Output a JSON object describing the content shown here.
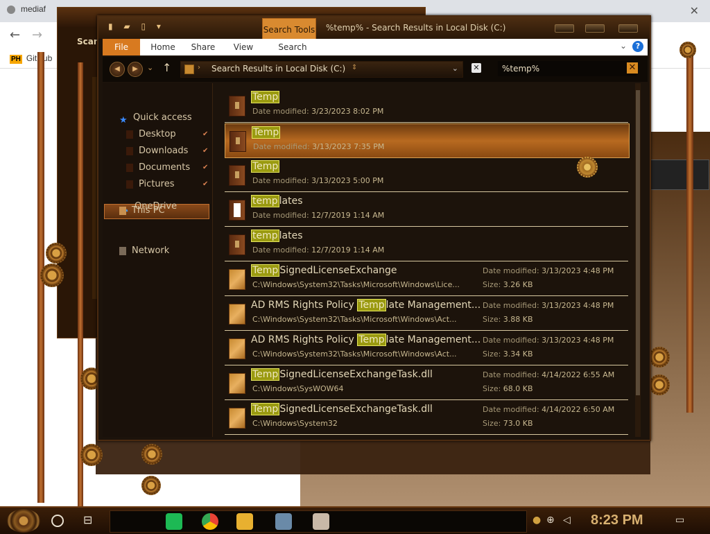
{
  "browser": {
    "tab_title": "mediaf",
    "bookmark": {
      "badge": "PH",
      "label": "GitHub"
    },
    "close": "✕"
  },
  "behind_window": {
    "label": "Scan"
  },
  "explorer": {
    "quick_access_icons": "▮ ▰ ▯ ▾",
    "search_tools_tab": "Search Tools",
    "window_title": "%temp% - Search Results in Local Disk (C:)",
    "ribbon": {
      "file": "File",
      "home": "Home",
      "share": "Share",
      "view": "View",
      "search": "Search",
      "help": "?"
    },
    "address": {
      "crumb": "Search Results in Local Disk (C:)"
    },
    "search": {
      "value": "%temp%",
      "close": "✕"
    },
    "nav": {
      "quick_access": "Quick access",
      "desktop": "Desktop",
      "downloads": "Downloads",
      "documents": "Documents",
      "pictures": "Pictures",
      "onedrive": "OneDrive",
      "this_pc": "This PC",
      "network": "Network"
    },
    "date_label": "Date modified:",
    "size_label": "Size:",
    "results": [
      {
        "hl": "Temp",
        "rest": "",
        "date": "3/23/2023 8:02 PM",
        "icon": "folder"
      },
      {
        "hl": "Temp",
        "rest": "",
        "date": "3/13/2023 7:35 PM",
        "icon": "folder"
      },
      {
        "hl": "Temp",
        "rest": "",
        "date": "3/13/2023 5:00 PM",
        "icon": "folder"
      },
      {
        "hl": "temp",
        "rest": "lates",
        "date": "12/7/2019 1:14 AM",
        "icon": "folder-white"
      },
      {
        "hl": "temp",
        "rest": "lates",
        "date": "12/7/2019 1:14 AM",
        "icon": "folder"
      },
      {
        "pre": "",
        "hl": "Temp",
        "rest": "SignedLicenseExchange",
        "path": "C:\\Windows\\System32\\Tasks\\Microsoft\\Windows\\Lice...",
        "date": "3/13/2023 4:48 PM",
        "size": "3.26 KB",
        "icon": "doc"
      },
      {
        "pre": "AD RMS Rights Policy ",
        "hl": "Temp",
        "rest": "late Management...",
        "path": "C:\\Windows\\System32\\Tasks\\Microsoft\\Windows\\Act...",
        "date": "3/13/2023 4:48 PM",
        "size": "3.88 KB",
        "icon": "doc"
      },
      {
        "pre": "AD RMS Rights Policy ",
        "hl": "Temp",
        "rest": "late Management...",
        "path": "C:\\Windows\\System32\\Tasks\\Microsoft\\Windows\\Act...",
        "date": "3/13/2023 4:48 PM",
        "size": "3.34 KB",
        "icon": "doc"
      },
      {
        "pre": "",
        "hl": "Temp",
        "rest": "SignedLicenseExchangeTask.dll",
        "path": "C:\\Windows\\SysWOW64",
        "date": "4/14/2022 6:55 AM",
        "size": "68.0 KB",
        "icon": "doc"
      },
      {
        "pre": "",
        "hl": "Temp",
        "rest": "SignedLicenseExchangeTask.dll",
        "path": "C:\\Windows\\System32",
        "date": "4/14/2022 6:50 AM",
        "size": "73.0 KB",
        "icon": "doc"
      }
    ]
  },
  "taskbar": {
    "clock": "8:23 PM"
  }
}
